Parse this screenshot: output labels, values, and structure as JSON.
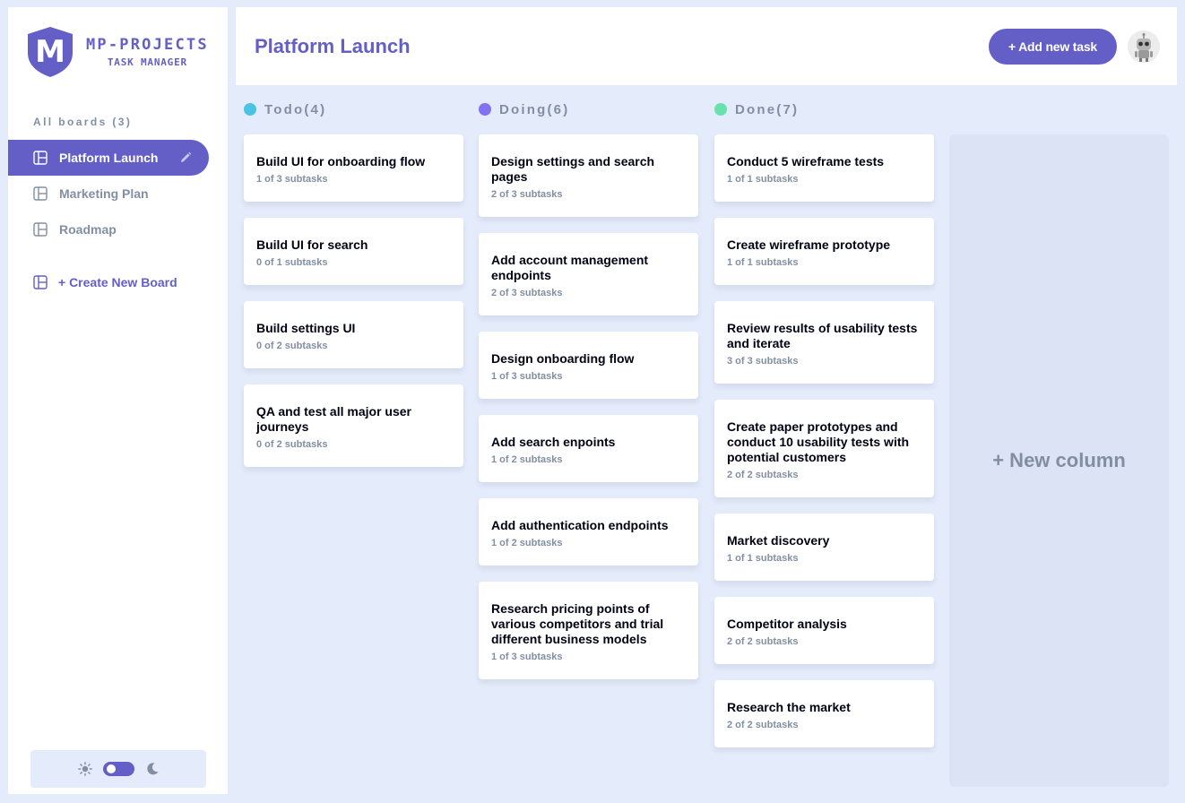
{
  "brand": {
    "title": "MP-PROJECTS",
    "subtitle": "TASK MANAGER",
    "logo_letter": "M"
  },
  "sidebar": {
    "heading": "All boards (3)",
    "boards": [
      {
        "label": "Platform Launch",
        "active": true
      },
      {
        "label": "Marketing Plan",
        "active": false
      },
      {
        "label": "Roadmap",
        "active": false
      }
    ],
    "create_label": "+ Create New Board"
  },
  "header": {
    "title": "Platform Launch",
    "add_task_label": "+ Add new task"
  },
  "columns": [
    {
      "title": "Todo(4)",
      "color": "#49c4e5",
      "tasks": [
        {
          "title": "Build UI for onboarding flow",
          "subtasks": "1 of 3 subtasks"
        },
        {
          "title": "Build UI for search",
          "subtasks": "0 of 1 subtasks"
        },
        {
          "title": "Build settings UI",
          "subtasks": "0 of 2 subtasks"
        },
        {
          "title": "QA and test all major user journeys",
          "subtasks": "0 of 2 subtasks"
        }
      ]
    },
    {
      "title": "Doing(6)",
      "color": "#8471f2",
      "tasks": [
        {
          "title": "Design settings and search pages",
          "subtasks": "2 of 3 subtasks"
        },
        {
          "title": "Add account management endpoints",
          "subtasks": "2 of 3 subtasks"
        },
        {
          "title": "Design onboarding flow",
          "subtasks": "1 of 3 subtasks"
        },
        {
          "title": "Add search enpoints",
          "subtasks": "1 of 2 subtasks"
        },
        {
          "title": "Add authentication endpoints",
          "subtasks": "1 of 2 subtasks"
        },
        {
          "title": "Research pricing points of various competitors and trial different business models",
          "subtasks": "1 of 3 subtasks"
        }
      ]
    },
    {
      "title": "Done(7)",
      "color": "#67e2ae",
      "tasks": [
        {
          "title": "Conduct 5 wireframe tests",
          "subtasks": "1 of 1 subtasks"
        },
        {
          "title": "Create wireframe prototype",
          "subtasks": "1 of 1 subtasks"
        },
        {
          "title": "Review results of usability tests and iterate",
          "subtasks": "3 of 3 subtasks"
        },
        {
          "title": "Create paper prototypes and conduct 10 usability tests with potential customers",
          "subtasks": "2 of 2 subtasks"
        },
        {
          "title": "Market discovery",
          "subtasks": "1 of 1 subtasks"
        },
        {
          "title": "Competitor analysis",
          "subtasks": "2 of 2 subtasks"
        },
        {
          "title": "Research the market",
          "subtasks": "2 of 2 subtasks"
        }
      ]
    }
  ],
  "new_column_label": "+ New column",
  "theme": {
    "mode": "light",
    "accent": "#635fc7"
  }
}
